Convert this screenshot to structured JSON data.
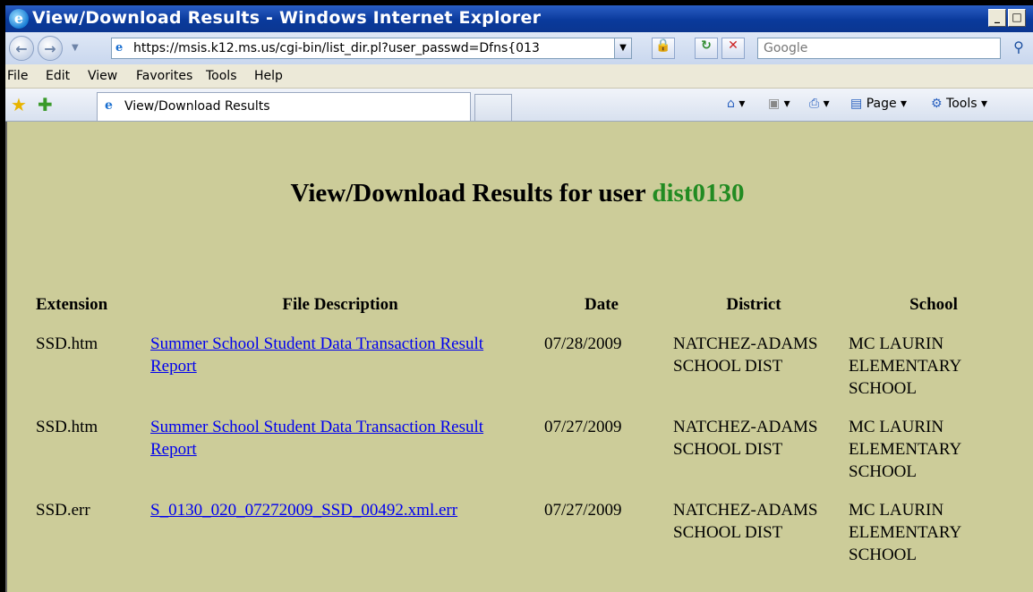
{
  "window": {
    "title": "View/Download Results - Windows Internet Explorer",
    "minimize_glyph": "_",
    "maximize_glyph": "□"
  },
  "address_bar": {
    "url": "https://msis.k12.ms.us/cgi-bin/list_dir.pl?user_passwd=Dfns{013",
    "search_placeholder": "Google",
    "security_icon": "lock-icon"
  },
  "menu": [
    "File",
    "Edit",
    "View",
    "Favorites",
    "Tools",
    "Help"
  ],
  "tab": {
    "label": "View/Download Results"
  },
  "command_bar": {
    "page_label": "Page",
    "tools_label": "Tools"
  },
  "page": {
    "heading_prefix": "View/Download Results for user",
    "username": "dist0130",
    "columns": {
      "extension": "Extension",
      "description": "File Description",
      "date": "Date",
      "district": "District",
      "school": "School"
    },
    "rows": [
      {
        "extension": "SSD.htm",
        "description": "Summer School Student Data Transaction Result Report",
        "date": "07/28/2009",
        "district": "NATCHEZ-ADAMS SCHOOL DIST",
        "school": "MC LAURIN ELEMENTARY SCHOOL"
      },
      {
        "extension": "SSD.htm",
        "description": "Summer School Student Data Transaction Result Report",
        "date": "07/27/2009",
        "district": "NATCHEZ-ADAMS SCHOOL DIST",
        "school": "MC LAURIN ELEMENTARY SCHOOL"
      },
      {
        "extension": "SSD.err",
        "description": "S_0130_020_07272009_SSD_00492.xml.err",
        "date": "07/27/2009",
        "district": "NATCHEZ-ADAMS SCHOOL DIST",
        "school": "MC LAURIN ELEMENTARY SCHOOL"
      }
    ]
  },
  "colors": {
    "page_background": "#cccc99",
    "username": "#228b22",
    "link": "#0000ee",
    "titlebar": "#0a3a9c"
  }
}
